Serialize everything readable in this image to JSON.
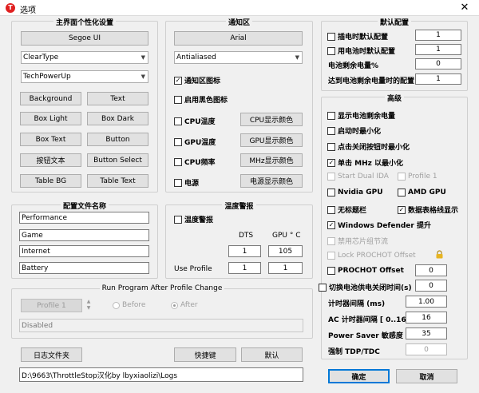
{
  "window": {
    "icon": "T",
    "title": "选项",
    "close": "✕"
  },
  "main_ui": {
    "title": "主界面个性化设置",
    "font_button": "Segoe UI",
    "render_mode": "ClearType",
    "theme": "TechPowerUp",
    "color_buttons": [
      "Background",
      "Text",
      "Box Light",
      "Box Dark",
      "Box Text",
      "Button",
      "按钮文本",
      "Button Select",
      "Table BG",
      "Table Text"
    ]
  },
  "notification": {
    "title": "通知区",
    "font_button": "Arial",
    "render_mode": "Antialiased",
    "show_icon_label": "通知区图标",
    "show_icon_checked": true,
    "dark_icon_label": "启用黑色图标",
    "items": [
      {
        "label": "CPU温度",
        "button": "CPU显示颜色"
      },
      {
        "label": "GPU温度",
        "button": "GPU显示颜色"
      },
      {
        "label": "CPU频率",
        "button": "MHz显示颜色"
      },
      {
        "label": "电源",
        "button": "电源显示颜色"
      }
    ]
  },
  "default_config": {
    "title": "默认配置",
    "rows": [
      {
        "label": "插电时默认配置",
        "value": "1"
      },
      {
        "label": "用电池时默认配置",
        "value": "1"
      }
    ],
    "battery_label": "电池剩余电量%",
    "battery_value": "0",
    "reach_label": "达到电池剩余电量时的配置",
    "reach_value": "1"
  },
  "advanced": {
    "title": "高级",
    "options": [
      "显示电池剩余电量",
      "启动时最小化",
      "点击关闭按钮时最小化",
      "单击 MHz 以最小化"
    ],
    "mhz_checked": true,
    "start_dual": "Start Dual IDA",
    "profile1": "Profile 1",
    "nvidia": "Nvidia GPU",
    "amd": "AMD GPU",
    "no_title": "无标题栏",
    "data_table": "数据表格线显示",
    "data_table_checked": true,
    "defender": "Windows Defender 提升",
    "defender_checked": true,
    "disable_throttle": "禁用芯片组节流",
    "lock_prochot": "Lock PROCHOT Offset",
    "prochot_label": "PROCHOT Offset",
    "prochot_value": "0",
    "switch_label": "切换电池供电关闭时间(s)",
    "switch_value": "0",
    "timer_label": "计时器间隔 (ms)",
    "timer_value": "1.00",
    "ac_label": "AC 计时器间隔 [ 0..16 ]",
    "ac_value": "16",
    "ps_label": "Power Saver 敏感度",
    "ps_value": "35",
    "tdp_label": "强制 TDP/TDC",
    "tdp_value": "0",
    "lock_icon": "lock-icon"
  },
  "profiles": {
    "title": "配置文件名称",
    "names": [
      "Performance",
      "Game",
      "Internet",
      "Battery"
    ]
  },
  "temp_alarm": {
    "title": "温度警报",
    "checkbox": "温度警报",
    "col_dts": "DTS",
    "col_gpu": "GPU ° C",
    "dts_value": "1",
    "gpu_value": "105",
    "use_profile": "Use Profile",
    "dts_profile": "1",
    "gpu_profile": "1"
  },
  "run_program": {
    "title": "Run Program After Profile Change",
    "profile_button": "Profile 1",
    "before": "Before",
    "after": "After",
    "status": "Disabled"
  },
  "bottom": {
    "log_button": "日志文件夹",
    "hotkey_button": "快捷键",
    "default_button": "默认",
    "log_path": "D:\\9663\\ThrottleStop汉化by lbyxiaolizi\\Logs",
    "ok": "确定",
    "cancel": "取消"
  }
}
